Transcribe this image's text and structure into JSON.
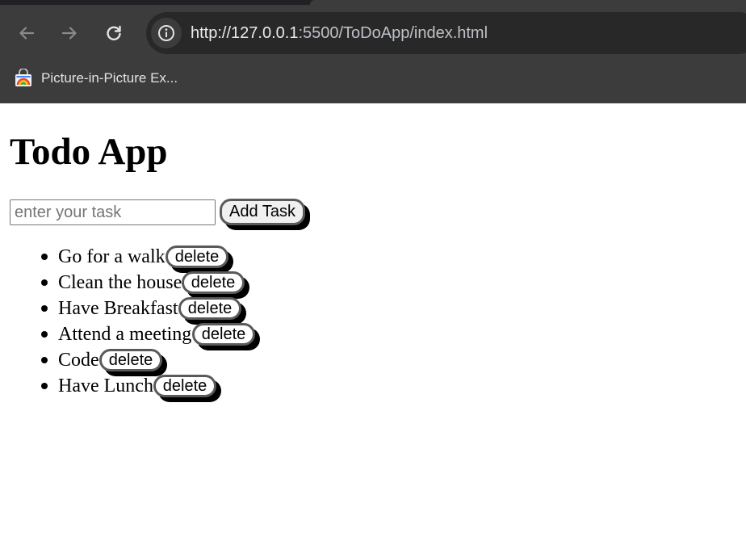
{
  "browser": {
    "url_host": "http://127.0.0.1",
    "url_rest": ":5500/ToDoApp/index.html",
    "bookmark_label": "Picture-in-Picture Ex...",
    "icons": [
      "back-arrow-icon",
      "forward-arrow-icon",
      "reload-icon",
      "site-info-icon",
      "picture-in-picture-extension-icon"
    ]
  },
  "app": {
    "title": "Todo App",
    "input_placeholder": "enter your task",
    "input_value": "",
    "add_button_label": "Add Task",
    "tasks": [
      {
        "text": "Go for a walk",
        "delete_label": "delete"
      },
      {
        "text": "Clean the house",
        "delete_label": "delete"
      },
      {
        "text": "Have Breakfast",
        "delete_label": "delete"
      },
      {
        "text": "Attend a meeting",
        "delete_label": "delete"
      },
      {
        "text": "Code",
        "delete_label": "delete"
      },
      {
        "text": "Have Lunch",
        "delete_label": "delete"
      }
    ]
  },
  "colors": {
    "chrome_bg": "#3c3c3c",
    "omnibox_bg": "#282828",
    "button_shadow": "#000000",
    "button_border": "#5a5a5a"
  }
}
